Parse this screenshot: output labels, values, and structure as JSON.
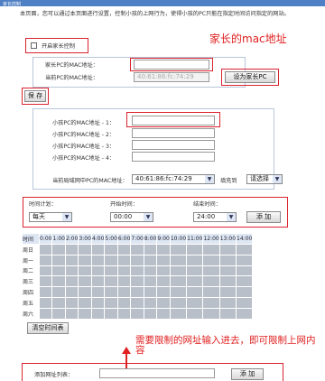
{
  "title": "家长控制",
  "description": "本页面，您可以通过本页面进行设置，控制小孩的上网行为，使得小孩的PC只能在指定时间访问指定的网站。",
  "annotation_mac": "家长的mac地址",
  "annotation_url": "需要限制的网址输入进去，即可限制上网内容",
  "enable_label": "开启家长控制",
  "parent_mac_label": "家长PC的MAC地址：",
  "current_mac_label": "当前PC的MAC地址：",
  "current_mac_value": "40:61:86:fc:74:29",
  "set_parent_button": "设为家长PC",
  "save_button": "保 存",
  "child_mac_labels": [
    "小孩PC的MAC地址 - 1：",
    "小孩PC的MAC地址 - 2：",
    "小孩PC的MAC地址 - 3：",
    "小孩PC的MAC地址 - 4："
  ],
  "lan_mac_label": "当前局域网中PC的MAC地址：",
  "lan_mac_value": "40:61:86:fc:74:29",
  "fill_to_label": "填充到",
  "fill_select": "请选择",
  "schedule": {
    "freq_label": "时间计划：",
    "start_label": "开始时间：",
    "end_label": "结束时间：",
    "freq_value": "每天",
    "start_value": "00:00",
    "end_value": "24:00",
    "add_button": "添 加"
  },
  "grid": {
    "time_label": "时间",
    "hours": [
      "0:00",
      "1:00",
      "2:00",
      "3:00",
      "4:00",
      "5:00",
      "6:00",
      "7:00",
      "8:00",
      "9:00",
      "10:00",
      "11:00",
      "12:00",
      "13:00",
      "14:00"
    ],
    "days": [
      "周日",
      "周一",
      "周二",
      "周三",
      "周四",
      "周五",
      "周六"
    ]
  },
  "clear_button": "清空时间表",
  "url_label": "添加网址列表：",
  "url_add_button": "添 加",
  "colors": {
    "annotation": "#e02020",
    "titlebar": "#4f7fc4",
    "grid_cell": "#b8bfc9"
  }
}
